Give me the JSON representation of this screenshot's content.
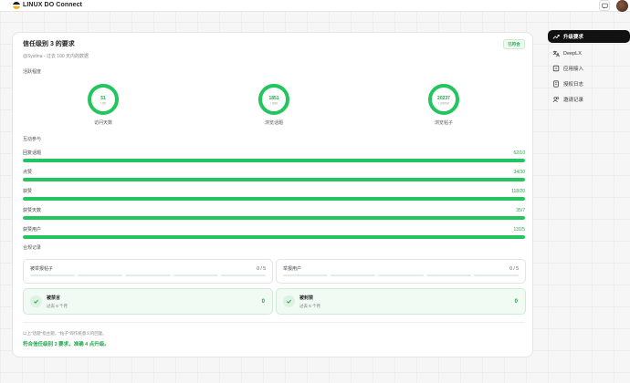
{
  "app": {
    "title": "LINUX DO Connect",
    "logo_colors": [
      "#1c1c1e",
      "#f0f0f0",
      "#f5b000"
    ]
  },
  "card": {
    "title": "信任级别 3 的要求",
    "badge": "已符合",
    "subtitle": "@Systina - 过去 100 天内的数据",
    "activity_title": "活跃程度",
    "rings": [
      {
        "value": "51",
        "target": "/ 50",
        "label": "访问天数",
        "progress": 1.0
      },
      {
        "value": "1851",
        "target": "/ 500",
        "label": "浏览话题",
        "progress": 1.0
      },
      {
        "value": "20237",
        "target": "/ 20000",
        "label": "浏览帖子",
        "progress": 1.0
      }
    ],
    "interaction_title": "互动参与",
    "bars": [
      {
        "label": "回复话题",
        "value": "62/10",
        "progress": 1.0
      },
      {
        "label": "点赞",
        "value": "34/30",
        "progress": 1.0
      },
      {
        "label": "获赞",
        "value": "118/20",
        "progress": 1.0
      },
      {
        "label": "获赞天数",
        "value": "35/7",
        "progress": 1.0
      },
      {
        "label": "获赞用户",
        "value": "131/5",
        "progress": 1.0
      }
    ],
    "compliance_title": "合规记录",
    "reports": [
      {
        "label": "被举报帖子",
        "value": "0 / 5"
      },
      {
        "label": "举报用户",
        "value": "0 / 5"
      }
    ],
    "bans": [
      {
        "title": "被禁言",
        "subtitle": "过去 6 个月",
        "count": "0"
      },
      {
        "title": "被封禁",
        "subtitle": "过去 6 个月",
        "count": "0"
      }
    ],
    "note": "以上\"话题\"指主题，\"帖子\"即作统意义的回复。",
    "verdict": "符合信任级别 3 要求，准确 4 点升级。"
  },
  "sidebar": {
    "items": [
      {
        "label": "升级要求",
        "icon": "trending-up-icon",
        "active": true
      },
      {
        "label": "DeepLX",
        "icon": "translate-icon",
        "active": false
      },
      {
        "label": "应用接入",
        "icon": "app-icon",
        "active": false
      },
      {
        "label": "授权日志",
        "icon": "log-icon",
        "active": false
      },
      {
        "label": "邀请记录",
        "icon": "users-icon",
        "active": false
      }
    ]
  },
  "colors": {
    "accent": "#22c55e",
    "accent_text": "#1fa64a",
    "active_nav": "#111111"
  }
}
